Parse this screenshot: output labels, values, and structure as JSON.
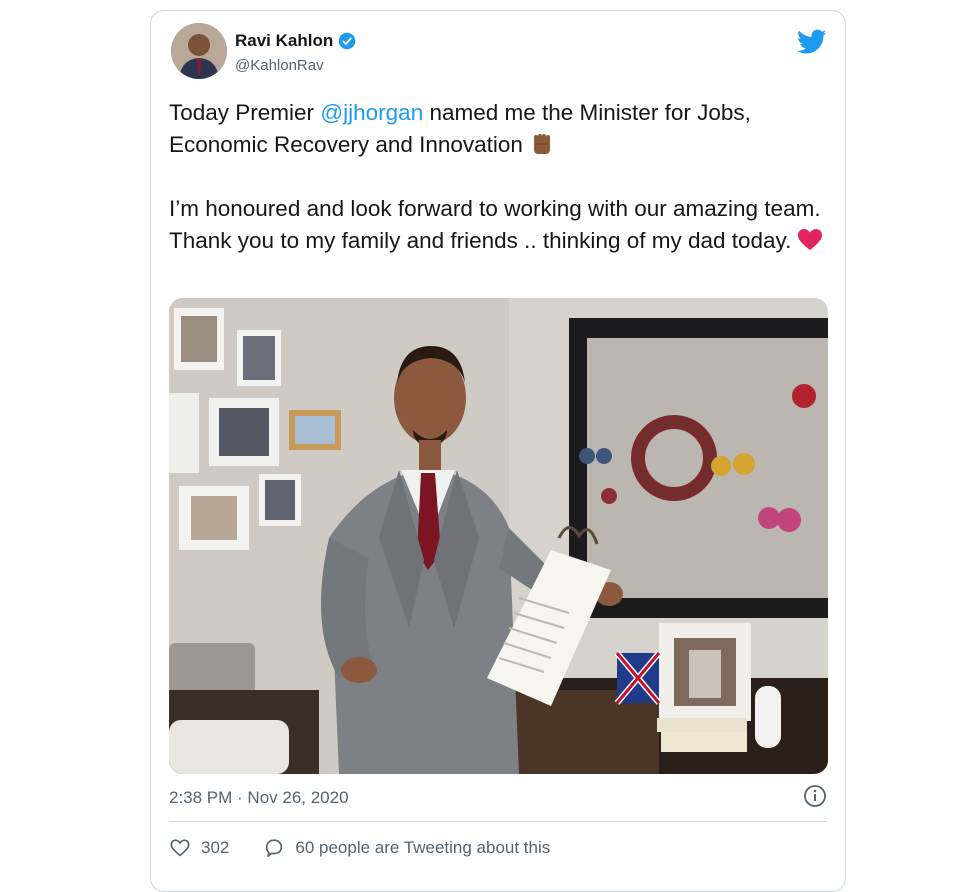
{
  "tweet": {
    "author_name": "Ravi Kahlon",
    "author_handle": "@KahlonRav",
    "text_before_mention": "Today Premier ",
    "mention": "@jjhorgan",
    "text_after_mention": " named me the Minister for Jobs, Economic Recovery and Innovation",
    "paragraph2": "I’m honoured and look forward to working with our amazing team. Thank you to my family and friends .. thinking of my dad today.",
    "timestamp": "2:38 PM · Nov 26, 2020",
    "likes": "302",
    "replies_text": "60 people are Tweeting about this"
  },
  "icons": {
    "verified": "verified-badge-icon",
    "brand": "twitter-bird-icon",
    "fist": "raised-fist-emoji",
    "heart": "red-heart-emoji",
    "info": "info-icon",
    "like": "heart-outline-icon",
    "reply": "speech-bubble-icon"
  },
  "colors": {
    "accent": "#1d9bf0",
    "text": "#14171a",
    "muted": "#536471",
    "heart": "#e0245e"
  }
}
